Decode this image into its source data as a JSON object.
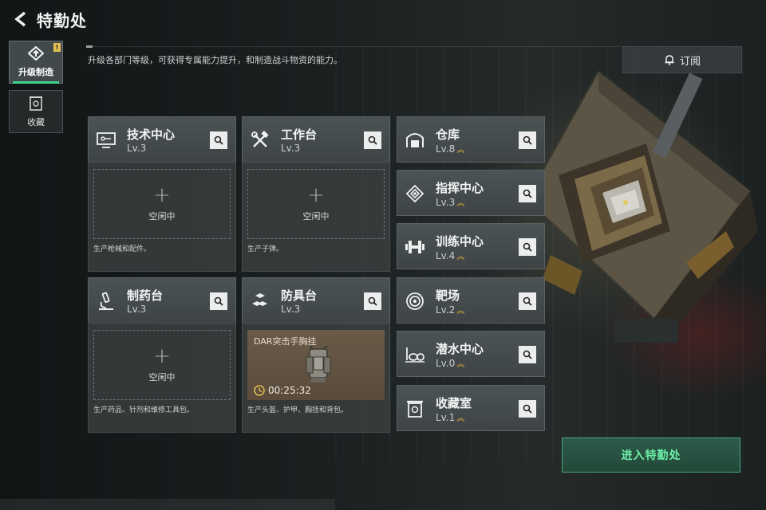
{
  "header": {
    "title": "特勤处"
  },
  "sidebar": {
    "tabs": [
      {
        "label": "升级制造",
        "active": true,
        "icon": "upgrade-icon",
        "badge": "!"
      },
      {
        "label": "收藏",
        "active": false,
        "icon": "collection-icon"
      }
    ]
  },
  "description": "升级各部门等级，可获得专属能力提升，和制造战斗物资的能力。",
  "subscribe": {
    "label": "订阅",
    "icon": "bell-icon"
  },
  "workshops": [
    {
      "name": "技术中心",
      "level": "Lv.3",
      "icon": "tech-icon",
      "slot": "空闲中",
      "footer": "生产枪械和配件。"
    },
    {
      "name": "工作台",
      "level": "Lv.3",
      "icon": "tools-icon",
      "slot": "空闲中",
      "footer": "生产子弹。"
    },
    {
      "name": "制药台",
      "level": "Lv.3",
      "icon": "microscope-icon",
      "slot": "空闲中",
      "footer": "生产药品、针剂和维修工具包。"
    },
    {
      "name": "防具台",
      "level": "Lv.3",
      "icon": "armor-icon",
      "craft_item": "DAR突击手胸挂",
      "timer": "00:25:32",
      "footer": "生产头盔、护甲、胸挂和背包。"
    }
  ],
  "facilities": [
    {
      "name": "仓库",
      "level": "Lv.8",
      "icon": "warehouse-icon",
      "upgradable": true
    },
    {
      "name": "指挥中心",
      "level": "Lv.3",
      "icon": "command-icon",
      "upgradable": true
    },
    {
      "name": "训练中心",
      "level": "Lv.4",
      "icon": "dumbbell-icon",
      "upgradable": true
    },
    {
      "name": "靶场",
      "level": "Lv.2",
      "icon": "target-icon",
      "upgradable": true
    },
    {
      "name": "潜水中心",
      "level": "Lv.0",
      "icon": "diving-icon",
      "upgradable": true
    },
    {
      "name": "收藏室",
      "level": "Lv.1",
      "icon": "collection-room-icon",
      "upgradable": true
    }
  ],
  "enter_button": {
    "label": "进入特勤处"
  },
  "colors": {
    "accent_green": "#3fd38a",
    "upgrade_gold": "#e3b23c",
    "enter_text": "#6ef0a8"
  }
}
